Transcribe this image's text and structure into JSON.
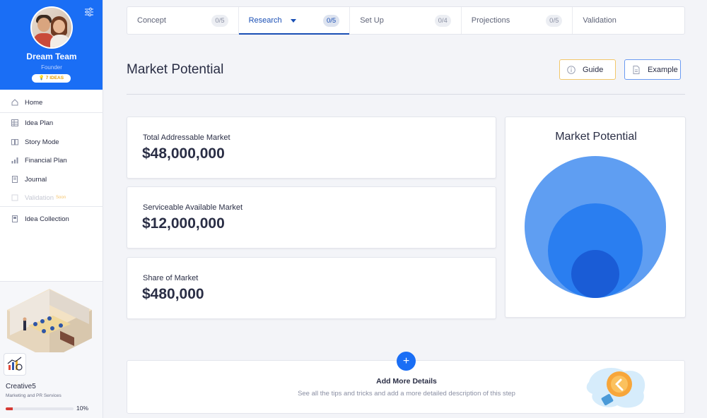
{
  "profile": {
    "team_name": "Dream Team",
    "role": "Founder",
    "ideas_badge": "7 IDEAS"
  },
  "sidebar": {
    "items": [
      {
        "label": "Home",
        "icon": "home-icon"
      },
      {
        "label": "Idea Plan",
        "icon": "grid-icon"
      },
      {
        "label": "Story Mode",
        "icon": "book-icon"
      },
      {
        "label": "Financial Plan",
        "icon": "bar-chart-icon"
      },
      {
        "label": "Journal",
        "icon": "journal-icon"
      },
      {
        "label": "Validation",
        "icon": "validation-icon",
        "tag": "Soon"
      },
      {
        "label": "Idea Collection",
        "icon": "collection-icon"
      }
    ]
  },
  "company": {
    "name": "Creative5",
    "subtitle": "Marketing and PR Services",
    "progress": 0.1,
    "progress_label": "10%"
  },
  "tabs": [
    {
      "label": "Concept",
      "count": "0/5"
    },
    {
      "label": "Research",
      "count": "0/5",
      "active": true
    },
    {
      "label": "Set Up",
      "count": "0/4"
    },
    {
      "label": "Projections",
      "count": "0/5"
    },
    {
      "label": "Validation",
      "count": ""
    }
  ],
  "page": {
    "title": "Market Potential",
    "guide_label": "Guide",
    "example_label": "Example"
  },
  "metrics": [
    {
      "label": "Total Addressable Market",
      "value": "$48,000,000"
    },
    {
      "label": "Serviceable Available Market",
      "value": "$12,000,000"
    },
    {
      "label": "Share of Market",
      "value": "$480,000"
    }
  ],
  "potential": {
    "title": "Market Potential",
    "colors": [
      "#5f9ef2",
      "#2a7ef0",
      "#1a5cd6"
    ]
  },
  "details": {
    "title": "Add More Details",
    "subtitle": "See all the tips and tricks and add a more detailed description of this step"
  },
  "colors": {
    "brand": "#1a6ef5",
    "active_tab": "#1a4fb5",
    "progress": "#d63a34"
  }
}
